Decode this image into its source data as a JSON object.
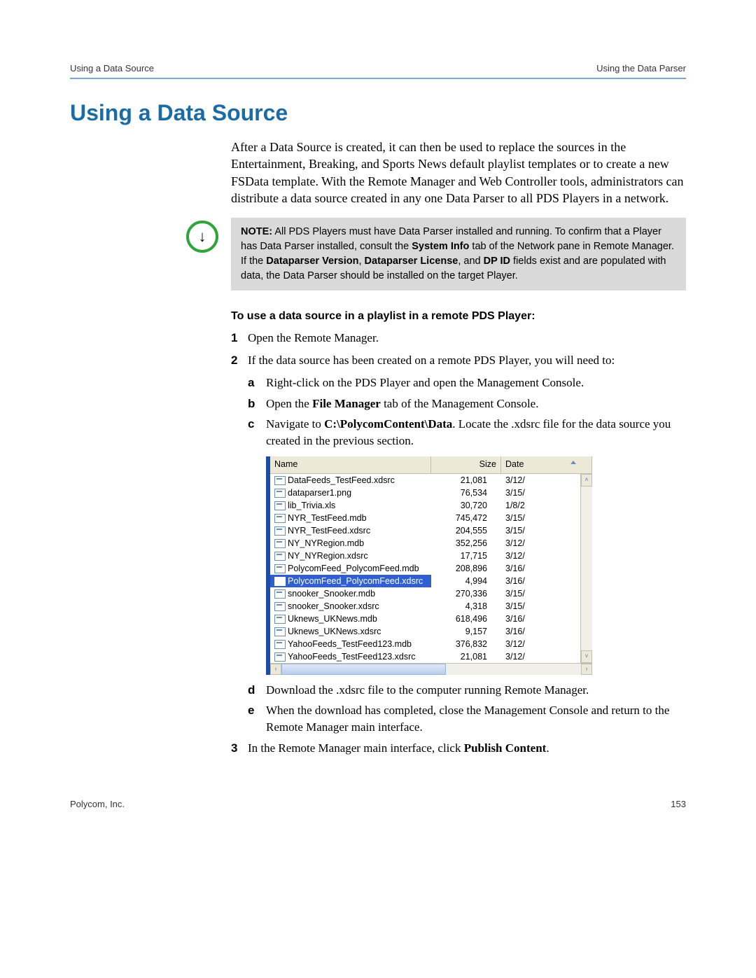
{
  "header": {
    "left": "Using a Data Source",
    "right": "Using the Data Parser"
  },
  "title": "Using a Data Source",
  "intro": "After a Data Source is created, it can then be used to replace the sources in the Entertainment, Breaking, and Sports News default playlist templates or to create a new FSData template. With the Remote Manager and Web Controller tools, administrators can distribute a data source created in any one Data Parser to all PDS Players in a network.",
  "note": {
    "label": "NOTE:",
    "t1": " All PDS Players must have Data Parser installed and running. To confirm that a Player has Data Parser installed, consult the ",
    "b1": "System Info",
    "t2": " tab of the Network pane in Remote Manager. If the ",
    "b2": "Dataparser Version",
    "t3": ", ",
    "b3": "Dataparser License",
    "t4": ", and ",
    "b4": "DP ID",
    "t5": " fields exist and are populated with data, the Data Parser should be installed on the target Player."
  },
  "subhead": "To use a data source in a playlist in a remote PDS Player:",
  "steps": {
    "s1_num": "1",
    "s1_text": "Open the Remote Manager.",
    "s2_num": "2",
    "s2_text": "If the data source has been created on a remote PDS Player, you will need to:",
    "s2a_label": "a",
    "s2a_text": "Right-click on the PDS Player and open the Management Console.",
    "s2b_label": "b",
    "s2b_t1": "Open the ",
    "s2b_b1": "File Manager",
    "s2b_t2": " tab of the Management Console.",
    "s2c_label": "c",
    "s2c_t1": "Navigate to ",
    "s2c_b1": "C:\\PolycomContent\\Data",
    "s2c_t2": ". Locate the .xdsrc file for the data source you created in the previous section.",
    "s2d_label": "d",
    "s2d_text": "Download the .xdsrc file to the computer running Remote Manager.",
    "s2e_label": "e",
    "s2e_text": "When the download has completed, close the Management Console and return to the Remote Manager main interface.",
    "s3_num": "3",
    "s3_t1": "In the Remote Manager main interface, click ",
    "s3_b1": "Publish Content",
    "s3_t2": "."
  },
  "filelist": {
    "headers": {
      "name": "Name",
      "size": "Size",
      "date": "Date"
    },
    "rows": [
      {
        "name": "DataFeeds_TestFeed.xdsrc",
        "size": "21,081",
        "date": "3/12/",
        "selected": false
      },
      {
        "name": "dataparser1.png",
        "size": "76,534",
        "date": "3/15/",
        "selected": false
      },
      {
        "name": "lib_Trivia.xls",
        "size": "30,720",
        "date": "1/8/2",
        "selected": false
      },
      {
        "name": "NYR_TestFeed.mdb",
        "size": "745,472",
        "date": "3/15/",
        "selected": false
      },
      {
        "name": "NYR_TestFeed.xdsrc",
        "size": "204,555",
        "date": "3/15/",
        "selected": false
      },
      {
        "name": "NY_NYRegion.mdb",
        "size": "352,256",
        "date": "3/12/",
        "selected": false
      },
      {
        "name": "NY_NYRegion.xdsrc",
        "size": "17,715",
        "date": "3/12/",
        "selected": false
      },
      {
        "name": "PolycomFeed_PolycomFeed.mdb",
        "size": "208,896",
        "date": "3/16/",
        "selected": false
      },
      {
        "name": "PolycomFeed_PolycomFeed.xdsrc",
        "size": "4,994",
        "date": "3/16/",
        "selected": true
      },
      {
        "name": "snooker_Snooker.mdb",
        "size": "270,336",
        "date": "3/15/",
        "selected": false
      },
      {
        "name": "snooker_Snooker.xdsrc",
        "size": "4,318",
        "date": "3/15/",
        "selected": false
      },
      {
        "name": "Uknews_UKNews.mdb",
        "size": "618,496",
        "date": "3/16/",
        "selected": false
      },
      {
        "name": "Uknews_UKNews.xdsrc",
        "size": "9,157",
        "date": "3/16/",
        "selected": false
      },
      {
        "name": "YahooFeeds_TestFeed123.mdb",
        "size": "376,832",
        "date": "3/12/",
        "selected": false
      },
      {
        "name": "YahooFeeds_TestFeed123.xdsrc",
        "size": "21,081",
        "date": "3/12/",
        "selected": false
      }
    ]
  },
  "footer": {
    "left": "Polycom, Inc.",
    "right": "153"
  }
}
